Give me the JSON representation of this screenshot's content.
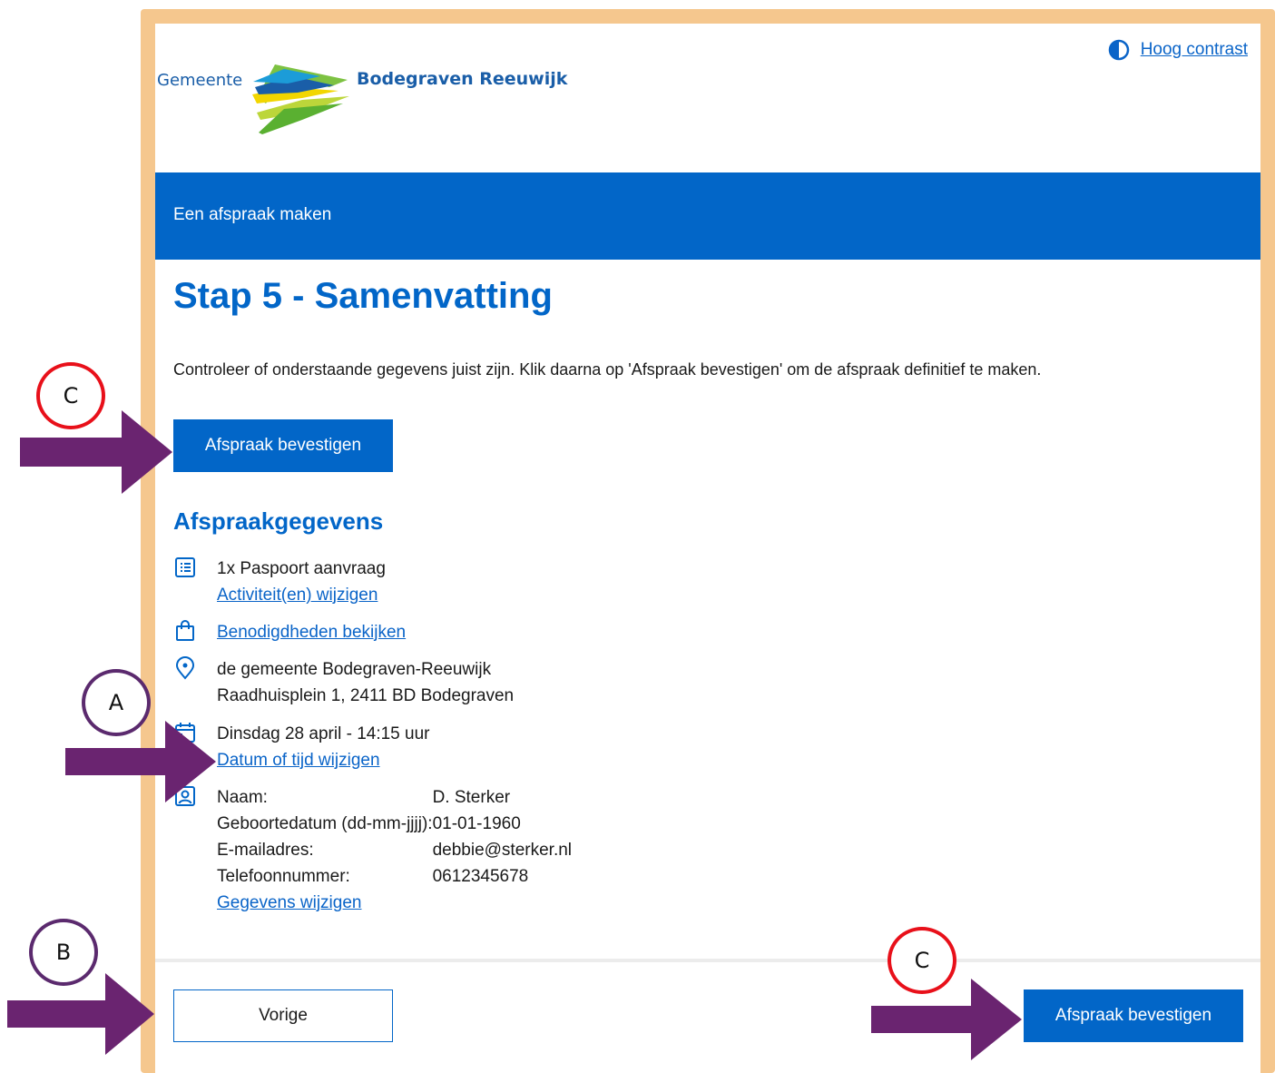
{
  "header": {
    "logo_prefix": "Gemeente",
    "logo_name": "Bodegraven Reeuwijk",
    "contrast_link": "Hoog contrast",
    "contrast_icon": "half-circle-icon"
  },
  "banner": {
    "title": "Een afspraak maken"
  },
  "main": {
    "heading": "Stap 5 - Samenvatting",
    "intro": "Controleer of onderstaande gegevens juist zijn. Klik daarna op 'Afspraak bevestigen' om de afspraak definitief te maken.",
    "confirm_label": "Afspraak bevestigen",
    "section_title": "Afspraakgegevens",
    "activity": {
      "icon": "list-icon",
      "text": "1x Paspoort aanvraag",
      "change_link": "Activiteit(en) wijzigen"
    },
    "requirements": {
      "icon": "shopping-bag-icon",
      "link": "Benodigdheden bekijken"
    },
    "location": {
      "icon": "location-pin-icon",
      "name": "de gemeente Bodegraven-Reeuwijk",
      "address": "Raadhuisplein 1, 2411 BD Bodegraven"
    },
    "datetime": {
      "icon": "calendar-icon",
      "text": "Dinsdag 28 april - 14:15 uur",
      "change_link": "Datum of tijd wijzigen"
    },
    "person": {
      "icon": "user-card-icon",
      "rows": [
        {
          "label": "Naam:",
          "value": "D. Sterker"
        },
        {
          "label": "Geboortedatum (dd-mm-jjjj):",
          "value": "01-01-1960"
        },
        {
          "label": "E-mailadres:",
          "value": "debbie@sterker.nl"
        },
        {
          "label": "Telefoonnummer:",
          "value": "0612345678"
        }
      ],
      "change_link": "Gegevens wijzigen"
    }
  },
  "footer": {
    "back_label": "Vorige",
    "confirm_label": "Afspraak bevestigen"
  },
  "annotations": {
    "marker_c_top": "C",
    "marker_a": "A",
    "marker_b": "B",
    "marker_c_bottom": "C",
    "marker_red_color": "#e8101a",
    "marker_purple_color": "#5b2a6e",
    "arrow_color": "#6a2470"
  },
  "colors": {
    "brand_blue": "#0266c8",
    "link_blue": "#0a64c8",
    "frame_orange": "#f5c78e"
  }
}
